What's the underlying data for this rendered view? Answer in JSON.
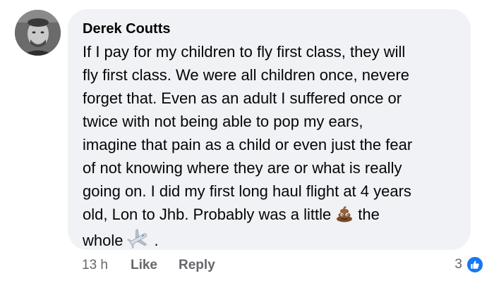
{
  "comment": {
    "author": "Derek Coutts",
    "lines": [
      "If I pay for my children to fly first class, they will",
      "fly first class. We were all children once, nevere",
      "forget that. Even as an adult I suffered once or",
      "twice with not being able to pop my ears,",
      "imagine that pain as a child or even just the fear",
      "of not knowing where they are or what is really",
      "going on. I did my first long haul flight at 4 years"
    ],
    "line8_before": "old, Lon to Jhb. Probably was a little",
    "line8_after": "the",
    "line9_before": "whole",
    "line9_after": "."
  },
  "actions": {
    "time": "13 h",
    "like": "Like",
    "reply": "Reply"
  },
  "reactions": {
    "count": "3"
  },
  "icons": {
    "emoji_1": "pile-of-poo-icon",
    "emoji_2": "airplane-icon",
    "reaction": "like-thumb-icon"
  },
  "colors": {
    "bubble": "#f0f2f5",
    "muted": "#65676b",
    "like_blue": "#1877f2"
  }
}
